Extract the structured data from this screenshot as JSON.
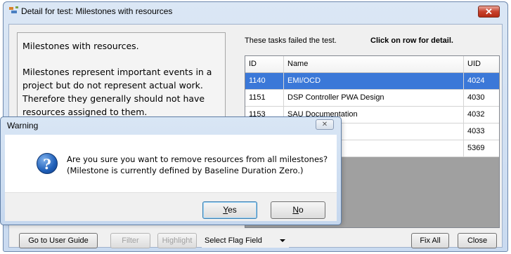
{
  "window": {
    "title": "Detail for test: Milestones with resources",
    "close_symbol": "✕"
  },
  "description": {
    "title": "Milestones with resources.",
    "body": "Milestones represent important events in a project but do not represent actual work. Therefore they generally should not have resources assigned to them."
  },
  "grid": {
    "caption": "These tasks failed the test.",
    "hint": "Click on row for detail.",
    "columns": [
      "ID",
      "Name",
      "UID"
    ],
    "rows": [
      {
        "id": "1140",
        "name": "EMI/OCD",
        "uid": "4024",
        "selected": true
      },
      {
        "id": "1151",
        "name": "DSP Controller PWA Design",
        "uid": "4030",
        "selected": false
      },
      {
        "id": "1153",
        "name": "SAU Documentation",
        "uid": "4032",
        "selected": false
      },
      {
        "id": "",
        "name": "",
        "uid": "4033",
        "selected": false
      },
      {
        "id": "",
        "name": "",
        "uid": "5369",
        "selected": false
      }
    ]
  },
  "toolbar": {
    "user_guide": "Go to User Guide",
    "filter": "Filter",
    "highlight": "Highlight",
    "flag_field": "Select Flag Field",
    "fix_all": "Fix All",
    "close": "Close"
  },
  "dialog": {
    "title": "Warning",
    "close_symbol": "✕",
    "line1": "Are you sure you want to remove resources from all milestones?",
    "line2": "(Milestone is currently defined by Baseline Duration Zero.)",
    "icon": "question-icon",
    "icon_glyph": "?",
    "yes_key": "Y",
    "yes_rest": "es",
    "no_key": "N",
    "no_rest": "o"
  },
  "colors": {
    "selection": "#3b78d8",
    "title_close": "#c7412c"
  }
}
